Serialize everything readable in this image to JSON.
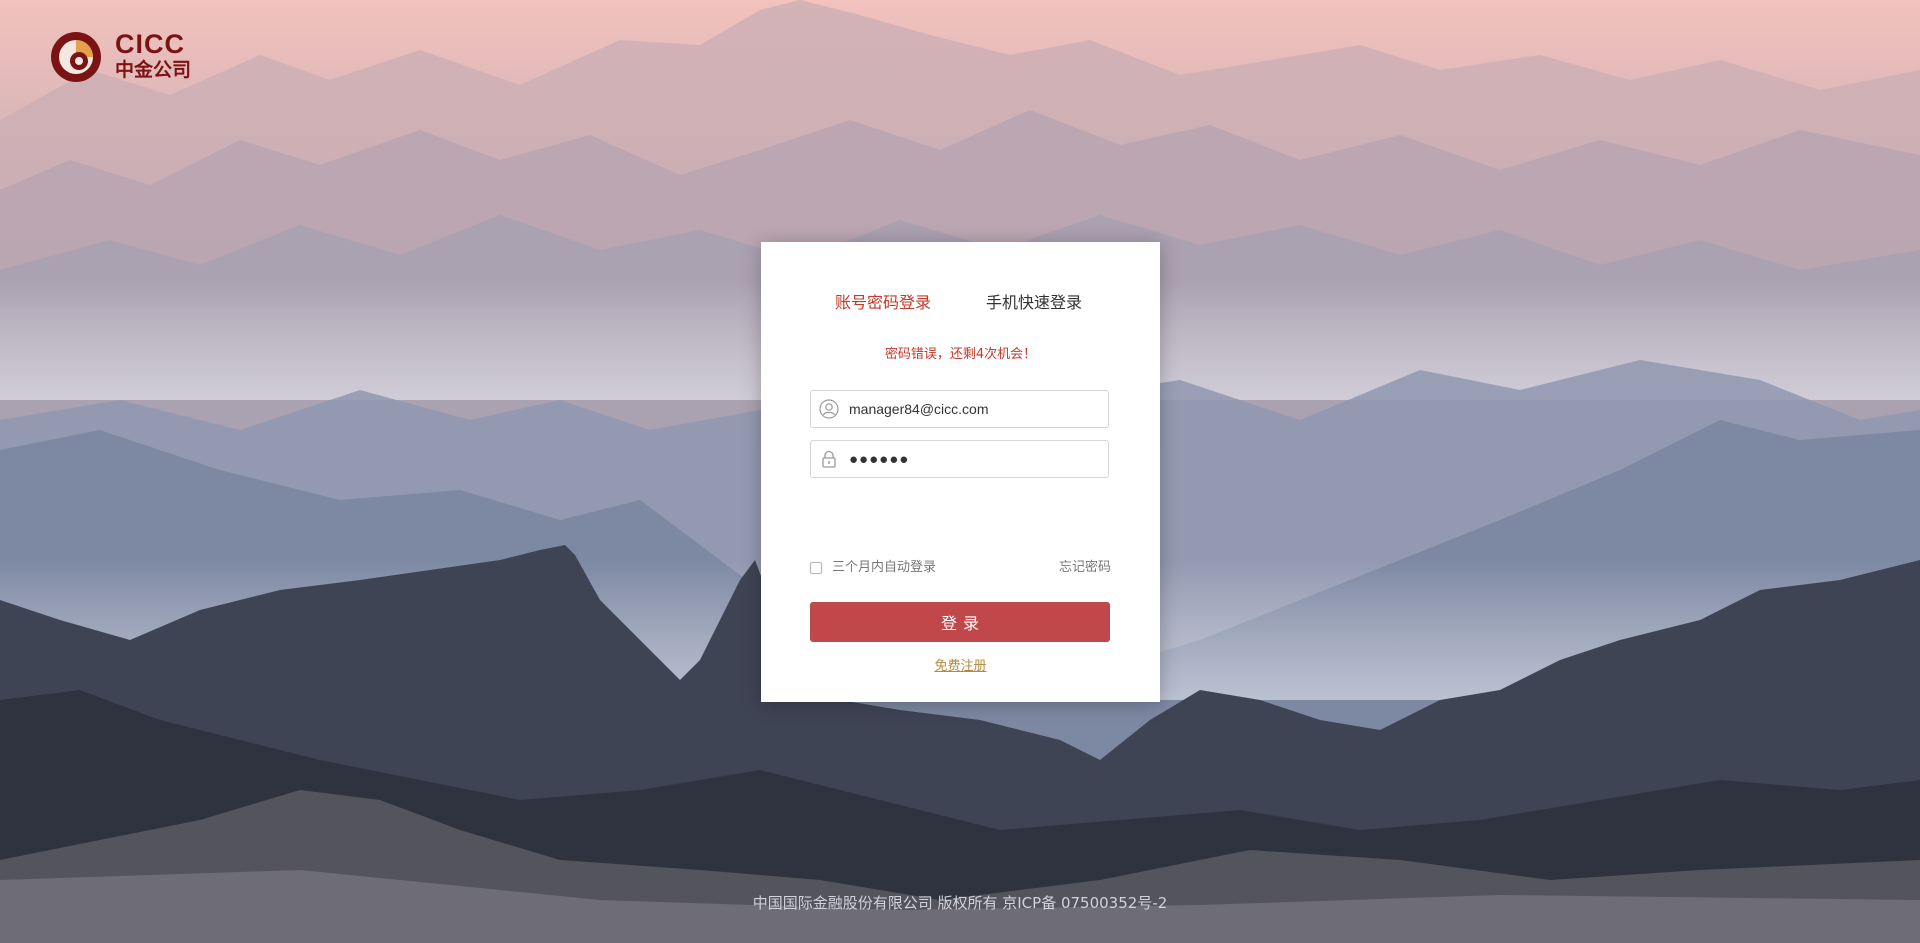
{
  "logo": {
    "brand_en": "CICC",
    "brand_cn": "中金公司"
  },
  "login": {
    "tabs": [
      {
        "label": "账号密码登录",
        "active": true
      },
      {
        "label": "手机快速登录",
        "active": false
      }
    ],
    "error_message": "密码错误，还剩4次机会！",
    "username": {
      "value": "manager84@cicc.com",
      "icon": "user-icon"
    },
    "password": {
      "value": "●●●●●●",
      "icon": "lock-icon"
    },
    "remember_label": "三个月内自动登录",
    "remember_checked": false,
    "forgot_label": "忘记密码",
    "submit_label": "登录",
    "register_label": "免费注册"
  },
  "footer": {
    "text": "中国国际金融股份有限公司 版权所有 京ICP备 07500352号-2"
  },
  "colors": {
    "accent": "#c0392b",
    "button": "#c0474a",
    "link": "#b38a3e",
    "brand": "#7a1414"
  }
}
